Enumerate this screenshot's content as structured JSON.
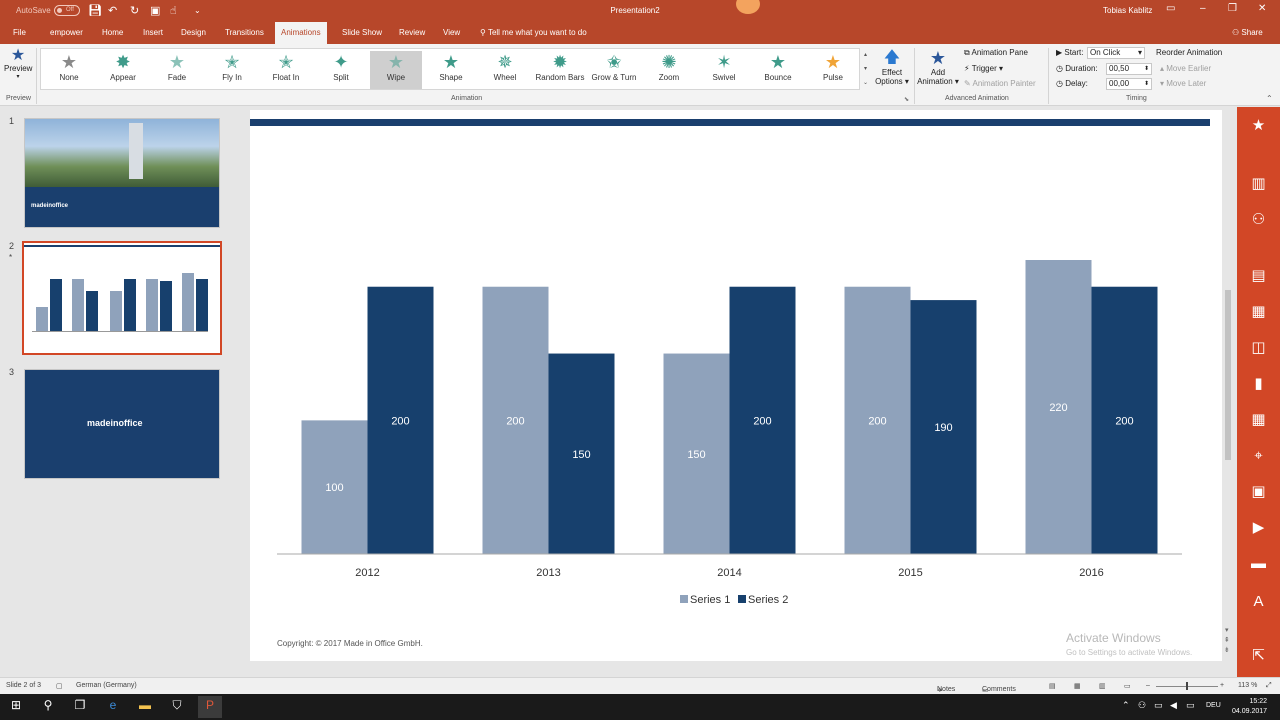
{
  "titlebar": {
    "autosave": "AutoSave",
    "autosave_state": "Off",
    "doc_title": "Presentation2",
    "user": "Tobias Kablitz"
  },
  "tabs": [
    "File",
    "empower",
    "Home",
    "Insert",
    "Design",
    "Transitions",
    "Animations",
    "Slide Show",
    "Review",
    "View"
  ],
  "active_tab": "Animations",
  "tell_me": "Tell me what you want to do",
  "share": "Share",
  "ribbon": {
    "preview_label": "Preview",
    "preview_group": "Preview",
    "animation_group": "Animation",
    "gallery": [
      "None",
      "Appear",
      "Fade",
      "Fly In",
      "Float In",
      "Split",
      "Wipe",
      "Shape",
      "Wheel",
      "Random Bars",
      "Grow & Turn",
      "Zoom",
      "Swivel",
      "Bounce",
      "Pulse"
    ],
    "hovered_item": "Wipe",
    "effect_options_line1": "Effect",
    "effect_options_line2": "Options",
    "add_animation_line1": "Add",
    "add_animation_line2": "Animation",
    "animation_pane": "Animation Pane",
    "trigger": "Trigger",
    "animation_painter": "Animation Painter",
    "advanced_group": "Advanced Animation",
    "start_label": "Start:",
    "start_value": "On Click",
    "duration_label": "Duration:",
    "duration_value": "00,50",
    "delay_label": "Delay:",
    "delay_value": "00,00",
    "reorder": "Reorder Animation",
    "move_earlier": "Move Earlier",
    "move_later": "Move Later",
    "timing_group": "Timing"
  },
  "thumbnails": {
    "numbers": [
      "1",
      "2",
      "3"
    ],
    "logo": "madeinoffice",
    "selected": 2
  },
  "slide": {
    "copyright": "Copyright: © 2017 Made in Office GmbH."
  },
  "watermark": {
    "line1": "Activate Windows",
    "line2": "Go to Settings to activate Windows."
  },
  "chart_data": {
    "type": "bar",
    "categories": [
      "2012",
      "2013",
      "2014",
      "2015",
      "2016"
    ],
    "series": [
      {
        "name": "Series 1",
        "values": [
          100,
          200,
          150,
          200,
          220
        ],
        "color": "#8fa2bb"
      },
      {
        "name": "Series 2",
        "values": [
          200,
          150,
          200,
          190,
          200
        ],
        "color": "#17406d"
      }
    ],
    "ylim": [
      0,
      220
    ],
    "data_labels": true,
    "legend": "bottom",
    "grid": false
  },
  "statusbar": {
    "slide_info": "Slide 2 of 3",
    "language": "German (Germany)",
    "notes": "Notes",
    "comments": "Comments",
    "zoom": "113 %"
  },
  "taskbar": {
    "language": "DEU",
    "time": "15:22",
    "date": "04.09.2017"
  },
  "colors": {
    "accent": "#b7472a",
    "sidebar": "#d24726",
    "slide_blue": "#1a3f6e"
  }
}
